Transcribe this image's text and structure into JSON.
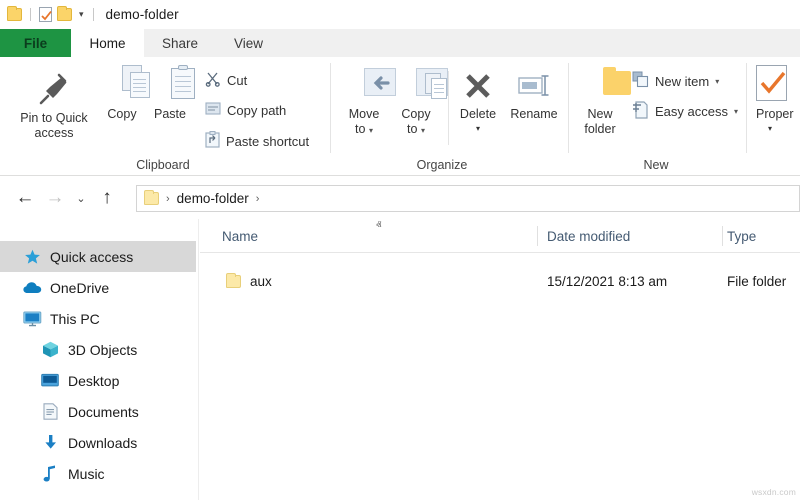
{
  "window": {
    "title": "demo-folder",
    "quick_access_toolbar": [
      {
        "name": "folder-icon",
        "tooltip": "Properties"
      },
      {
        "name": "properties-icon",
        "tooltip": "Properties"
      },
      {
        "name": "new-folder-icon",
        "tooltip": "New folder"
      },
      {
        "name": "customize-caret-icon",
        "label": "▾"
      }
    ]
  },
  "tabs": [
    {
      "id": "file",
      "label": "File",
      "active": false,
      "color": "#1e9443"
    },
    {
      "id": "home",
      "label": "Home",
      "active": true
    },
    {
      "id": "share",
      "label": "Share",
      "active": false
    },
    {
      "id": "view",
      "label": "View",
      "active": false
    }
  ],
  "ribbon": {
    "groups": [
      {
        "id": "clipboard",
        "label": "Clipboard",
        "large_buttons": [
          {
            "id": "pin-to-quick-access",
            "label_line1": "Pin to Quick",
            "label_line2": "access",
            "icon": "pin-icon"
          },
          {
            "id": "copy",
            "label_line1": "Copy",
            "label_line2": "",
            "icon": "copy-documents-icon"
          },
          {
            "id": "paste",
            "label_line1": "Paste",
            "label_line2": "",
            "icon": "clipboard-icon"
          }
        ],
        "small_buttons": [
          {
            "id": "cut",
            "label": "Cut",
            "icon": "scissors-icon"
          },
          {
            "id": "copy-path",
            "label": "Copy path",
            "icon": "copy-path-icon"
          },
          {
            "id": "paste-shortcut",
            "label": "Paste shortcut",
            "icon": "paste-shortcut-icon"
          }
        ]
      },
      {
        "id": "organize",
        "label": "Organize",
        "large_buttons": [
          {
            "id": "move-to",
            "label_line1": "Move",
            "label_line2": "to",
            "icon": "move-to-icon",
            "caret": "▾"
          },
          {
            "id": "copy-to",
            "label_line1": "Copy",
            "label_line2": "to",
            "icon": "copy-to-icon",
            "caret": "▾"
          },
          {
            "id": "delete",
            "label_line1": "Delete",
            "label_line2": "",
            "icon": "delete-x-icon",
            "caret": "▾"
          },
          {
            "id": "rename",
            "label_line1": "Rename",
            "label_line2": "",
            "icon": "rename-icon"
          }
        ],
        "small_buttons": []
      },
      {
        "id": "new",
        "label": "New",
        "large_buttons": [
          {
            "id": "new-folder",
            "label_line1": "New",
            "label_line2": "folder",
            "icon": "new-folder-icon"
          }
        ],
        "small_buttons": [
          {
            "id": "new-item",
            "label": "New item",
            "icon": "new-item-icon",
            "caret": "▾"
          },
          {
            "id": "easy-access",
            "label": "Easy access",
            "icon": "easy-access-icon",
            "caret": "▾"
          }
        ]
      },
      {
        "id": "open",
        "label": "",
        "large_buttons": [
          {
            "id": "properties",
            "label_line1": "Proper",
            "label_line2": "",
            "icon": "properties-icon",
            "caret": "▾"
          }
        ],
        "small_buttons": []
      }
    ]
  },
  "navigation": {
    "back": {
      "label": "←",
      "enabled": true
    },
    "forward": {
      "label": "→",
      "enabled": false
    },
    "recent": {
      "label": "⌄",
      "enabled": true
    },
    "up": {
      "label": "↑",
      "enabled": true
    },
    "breadcrumb": {
      "folder_icon": "folder-icon",
      "separator1": "›",
      "crumb": "demo-folder",
      "separator2": "›"
    }
  },
  "sidebar": {
    "items": [
      {
        "id": "quick-access",
        "label": "Quick access",
        "icon": "star-icon",
        "selected": true,
        "indent": false
      },
      {
        "id": "onedrive",
        "label": "OneDrive",
        "icon": "cloud-icon",
        "selected": false,
        "indent": false
      },
      {
        "id": "this-pc",
        "label": "This PC",
        "icon": "monitor-icon",
        "selected": false,
        "indent": false
      },
      {
        "id": "3d-objects",
        "label": "3D Objects",
        "icon": "cube-icon",
        "selected": false,
        "indent": true
      },
      {
        "id": "desktop",
        "label": "Desktop",
        "icon": "desktop-icon",
        "selected": false,
        "indent": true
      },
      {
        "id": "documents",
        "label": "Documents",
        "icon": "document-icon",
        "selected": false,
        "indent": true
      },
      {
        "id": "downloads",
        "label": "Downloads",
        "icon": "download-arrow-icon",
        "selected": false,
        "indent": true
      },
      {
        "id": "music",
        "label": "Music",
        "icon": "music-note-icon",
        "selected": false,
        "indent": true
      }
    ]
  },
  "file_list": {
    "columns": [
      {
        "id": "name",
        "label": "Name",
        "sorted": true,
        "sort_caret": "ⱏ"
      },
      {
        "id": "date-modified",
        "label": "Date modified",
        "sorted": false
      },
      {
        "id": "type",
        "label": "Type",
        "sorted": false
      }
    ],
    "rows": [
      {
        "icon": "folder-icon",
        "name": "aux",
        "date_modified": "15/12/2021 8:13 am",
        "type": "File folder"
      }
    ]
  },
  "watermark": "wsxdn.com"
}
